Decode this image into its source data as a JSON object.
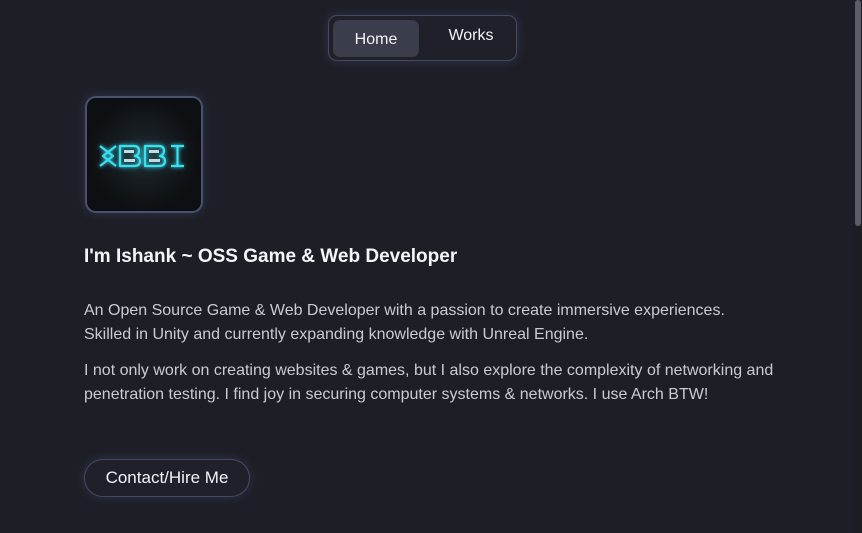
{
  "nav": {
    "items": [
      {
        "label": "Home",
        "active": true
      },
      {
        "label": "Works",
        "active": false
      }
    ]
  },
  "profile": {
    "logo_text": "BBI",
    "headline": "I'm Ishank ~ OSS Game & Web Developer",
    "paragraphs": [
      "An Open Source Game & Web Developer with a passion to create immersive experiences. Skilled in Unity and currently expanding knowledge with Unreal Engine.",
      "I not only work on creating websites & games, but I also explore the complexity of networking and penetration testing. I find joy in securing computer systems & networks. I use Arch BTW!"
    ],
    "contact_label": "Contact/Hire Me"
  },
  "colors": {
    "background": "#1e1f26",
    "accent_glow": "#5a6ec8",
    "logo_cyan": "#37e0f0"
  }
}
